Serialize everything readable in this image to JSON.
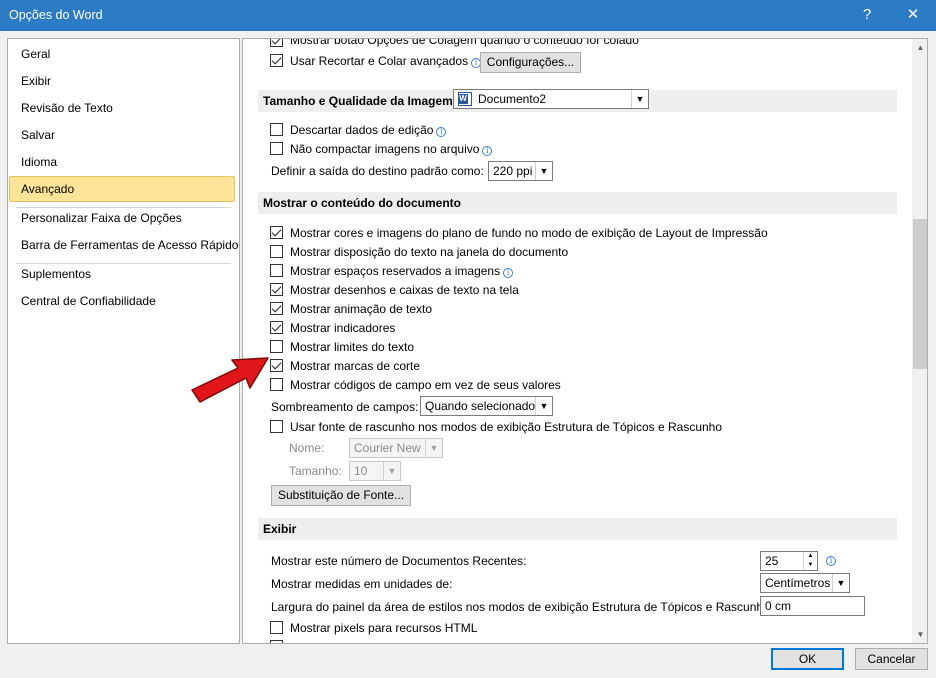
{
  "window": {
    "title": "Opções do Word",
    "help_glyph": "?",
    "close_glyph": "✕"
  },
  "nav": {
    "items": [
      "Geral",
      "Exibir",
      "Revisão de Texto",
      "Salvar",
      "Idioma",
      "Avançado",
      "Personalizar Faixa de Opções",
      "Barra de Ferramentas de Acesso Rápido",
      "Suplementos",
      "Central de Confiabilidade"
    ],
    "selected": "Avançado"
  },
  "paste": {
    "partial": "Mostrar botão Opções de Colagem quando o conteúdo for colado",
    "smart_cut": "Usar Recortar e Colar avançados",
    "config_button": "Configurações..."
  },
  "image": {
    "section": "Tamanho e Qualidade da Imagem",
    "document": "Documento2",
    "discard": "Descartar dados de edição",
    "no_compress": "Não compactar imagens no arquivo",
    "resolution_label": "Definir a saída do destino padrão como:",
    "resolution_value": "220 ppi"
  },
  "show_content": {
    "section": "Mostrar o conteúdo do documento",
    "options": [
      {
        "label": "Mostrar cores e imagens do plano de fundo no modo de exibição de Layout de Impressão",
        "checked": true
      },
      {
        "label": "Mostrar disposição do texto na janela do documento",
        "checked": false
      },
      {
        "label": "Mostrar espaços reservados a imagens",
        "checked": false,
        "info": true
      },
      {
        "label": "Mostrar desenhos e caixas de texto na tela",
        "checked": true
      },
      {
        "label": "Mostrar animação de texto",
        "checked": true
      },
      {
        "label": "Mostrar indicadores",
        "checked": true
      },
      {
        "label": "Mostrar limites do texto",
        "checked": false
      },
      {
        "label": "Mostrar marcas de corte",
        "checked": true
      },
      {
        "label": "Mostrar códigos de campo em vez de seus valores",
        "checked": false
      }
    ],
    "shading_label": "Sombreamento de campos:",
    "shading_value": "Quando selecionado",
    "draft_font": "Usar fonte de rascunho nos modos de exibição Estrutura de Tópicos e Rascunho",
    "name_label": "Nome:",
    "name_value": "Courier New",
    "size_label": "Tamanho:",
    "size_value": "10",
    "font_subst_button": "Substituição de Fonte..."
  },
  "display": {
    "section": "Exibir",
    "recent_label": "Mostrar este número de Documentos Recentes:",
    "recent_value": "25",
    "units_label": "Mostrar medidas em unidades de:",
    "units_value": "Centímetros",
    "style_width_label": "Largura do painel da área de estilos nos modos de exibição Estrutura de Tópicos e Rascunho:",
    "style_width_value": "0 cm",
    "pixels_html": "Mostrar pixels para recursos HTML"
  },
  "footer": {
    "ok": "OK",
    "cancel": "Cancelar"
  },
  "colors": {
    "titlebar": "#2b7cc4",
    "selected_nav": "#fde498",
    "annotation_arrow": "#e0161b"
  }
}
